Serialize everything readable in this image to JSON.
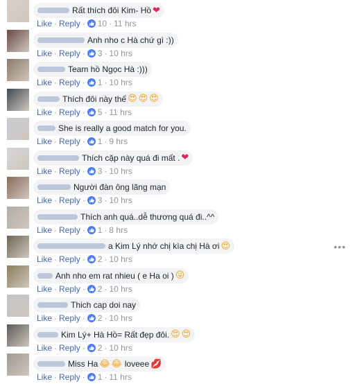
{
  "actions": {
    "like": "Like",
    "reply": "Reply",
    "separator": "·"
  },
  "colors": {
    "link": "#4267b2",
    "bubble": "#f2f3f5",
    "meta": "#90949c",
    "like_badge": "#4d7cfe"
  },
  "comments": [
    {
      "text": "Rất thích đôi Kim- Hồ",
      "emoji": [
        "red-heart"
      ],
      "likes": "10",
      "time": "11 hrs"
    },
    {
      "text": "Anh nho c Hà chứ gì :))",
      "emoji": [],
      "likes": "3",
      "time": "10 hrs"
    },
    {
      "text": "Team hồ Ngọc Hà :)))",
      "emoji": [],
      "likes": "1",
      "time": "10 hrs"
    },
    {
      "text": "Thích đôi này thế",
      "emoji": [
        "heart-eyes",
        "heart-eyes",
        "heart-eyes"
      ],
      "likes": "5",
      "time": "11 hrs"
    },
    {
      "text": "She is really a good match for you.",
      "emoji": [],
      "likes": "1",
      "time": "9 hrs"
    },
    {
      "text": "Thích cặp này quá đi mất .",
      "emoji": [
        "red-heart"
      ],
      "likes": "3",
      "time": "10 hrs"
    },
    {
      "text": "Người đàn ông lãng mạn",
      "emoji": [],
      "likes": "3",
      "time": "10 hrs"
    },
    {
      "text": "Thích anh quá..dễ thương quá đi..^^",
      "emoji": [],
      "likes": "1",
      "time": "8 hrs"
    },
    {
      "text": "a Kim Lý nhớ chị kìa chị Hà ơi",
      "emoji": [
        "heart-eyes"
      ],
      "likes": "2",
      "time": "10 hrs"
    },
    {
      "text": "Anh nho em rat nhieu ( e Ha oi )",
      "emoji": [
        "tongue-wink"
      ],
      "likes": "2",
      "time": "10 hrs"
    },
    {
      "text": "Thich cap doi nay",
      "emoji": [],
      "likes": "2",
      "time": "10 hrs"
    },
    {
      "text": "Kim Lý+ Hà Hồ= Rất đẹp đôi.",
      "emoji": [
        "heart-eyes",
        "heart-eyes"
      ],
      "likes": "2",
      "time": "10 hrs"
    },
    {
      "text": "Miss Ha",
      "emoji": [
        "tears-of-joy",
        "tears-of-joy"
      ],
      "text2": "loveee",
      "emoji2": [
        "kiss-mark"
      ],
      "likes": "1",
      "time": "11 hrs"
    }
  ]
}
